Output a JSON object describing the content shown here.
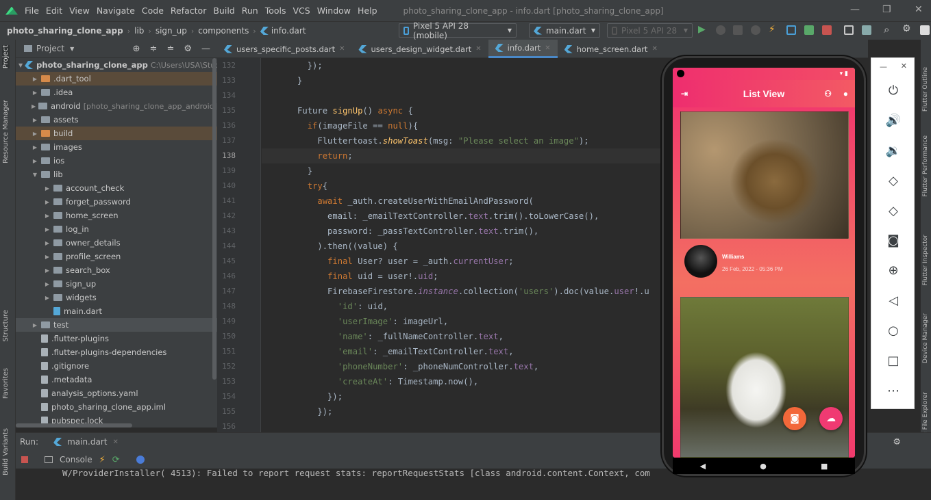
{
  "menubar": {
    "items": [
      "File",
      "Edit",
      "View",
      "Navigate",
      "Code",
      "Refactor",
      "Build",
      "Run",
      "Tools",
      "VCS",
      "Window",
      "Help"
    ],
    "window_title": "photo_sharing_clone_app - info.dart [photo_sharing_clone_app]"
  },
  "breadcrumb": {
    "items": [
      "photo_sharing_clone_app",
      "lib",
      "sign_up",
      "components",
      "info.dart"
    ]
  },
  "toolbar": {
    "device": "Pixel 5 API 28 (mobile)",
    "run_config": "main.dart",
    "device_disabled": "Pixel 5 API 28"
  },
  "project_panel": {
    "title": "Project",
    "root": {
      "name": "photo_sharing_clone_app",
      "path": "C:\\Users\\USA\\Studio"
    },
    "items": [
      {
        "label": ".dart_tool",
        "depth": 1,
        "expandable": true,
        "kind": "folder-orange"
      },
      {
        "label": ".idea",
        "depth": 1,
        "expandable": true,
        "kind": "folder"
      },
      {
        "label": "android",
        "hint": "[photo_sharing_clone_app_android]",
        "depth": 1,
        "expandable": true,
        "kind": "folder"
      },
      {
        "label": "assets",
        "depth": 1,
        "expandable": true,
        "kind": "folder"
      },
      {
        "label": "build",
        "depth": 1,
        "expandable": true,
        "kind": "folder-orange"
      },
      {
        "label": "images",
        "depth": 1,
        "expandable": true,
        "kind": "folder"
      },
      {
        "label": "ios",
        "depth": 1,
        "expandable": true,
        "kind": "folder"
      },
      {
        "label": "lib",
        "depth": 1,
        "expandable": true,
        "expanded": true,
        "kind": "folder"
      },
      {
        "label": "account_check",
        "depth": 2,
        "expandable": true,
        "kind": "folder"
      },
      {
        "label": "forget_password",
        "depth": 2,
        "expandable": true,
        "kind": "folder"
      },
      {
        "label": "home_screen",
        "depth": 2,
        "expandable": true,
        "kind": "folder"
      },
      {
        "label": "log_in",
        "depth": 2,
        "expandable": true,
        "kind": "folder"
      },
      {
        "label": "owner_details",
        "depth": 2,
        "expandable": true,
        "kind": "folder"
      },
      {
        "label": "profile_screen",
        "depth": 2,
        "expandable": true,
        "kind": "folder"
      },
      {
        "label": "search_box",
        "depth": 2,
        "expandable": true,
        "kind": "folder"
      },
      {
        "label": "sign_up",
        "depth": 2,
        "expandable": true,
        "kind": "folder"
      },
      {
        "label": "widgets",
        "depth": 2,
        "expandable": true,
        "kind": "folder"
      },
      {
        "label": "main.dart",
        "depth": 2,
        "expandable": false,
        "kind": "dart"
      },
      {
        "label": "test",
        "depth": 1,
        "expandable": true,
        "kind": "folder",
        "selected": true
      },
      {
        "label": ".flutter-plugins",
        "depth": 1,
        "expandable": false,
        "kind": "file"
      },
      {
        "label": ".flutter-plugins-dependencies",
        "depth": 1,
        "expandable": false,
        "kind": "file"
      },
      {
        "label": ".gitignore",
        "depth": 1,
        "expandable": false,
        "kind": "file"
      },
      {
        "label": ".metadata",
        "depth": 1,
        "expandable": false,
        "kind": "file"
      },
      {
        "label": "analysis_options.yaml",
        "depth": 1,
        "expandable": false,
        "kind": "file"
      },
      {
        "label": "photo_sharing_clone_app.iml",
        "depth": 1,
        "expandable": false,
        "kind": "file"
      },
      {
        "label": "pubspec.lock",
        "depth": 1,
        "expandable": false,
        "kind": "file"
      }
    ]
  },
  "editor": {
    "tabs": [
      {
        "label": "users_specific_posts.dart",
        "active": false
      },
      {
        "label": "users_design_widget.dart",
        "active": false
      },
      {
        "label": "info.dart",
        "active": true
      },
      {
        "label": "home_screen.dart",
        "active": false
      }
    ],
    "line_numbers": [
      "132",
      "133",
      "134",
      "135",
      "136",
      "137",
      "138",
      "139",
      "140",
      "141",
      "142",
      "143",
      "144",
      "145",
      "146",
      "147",
      "148",
      "149",
      "150",
      "151",
      "152",
      "153",
      "154",
      "155",
      "156"
    ],
    "current_line": "138"
  },
  "left_strip": [
    "Project",
    "Resource Manager",
    "Structure",
    "Favorites",
    "Build Variants"
  ],
  "right_strip": [
    "Flutter Outline",
    "Flutter Performance",
    "Flutter Inspector",
    "Device Manager",
    "Device File Explorer"
  ],
  "run_panel": {
    "run_label": "Run:",
    "config_tab": "main.dart",
    "console_tab": "Console",
    "log_line": "W/ProviderInstaller( 4513): Failed to report request stats: reportRequestStats [class android.content.Context, com"
  },
  "phone": {
    "app_title": "List View",
    "post_user_name": "Williams",
    "post_date": "26 Feb, 2022 - 05:36 PM",
    "colors": {
      "primary": "#ee2d6f",
      "secondary": "#f36f62",
      "fab_camera": "#f36f3a",
      "fab_upload": "#f03a72"
    }
  },
  "emulator_controls": [
    "power-icon",
    "volume-up-icon",
    "volume-down-icon",
    "rotate-left-icon",
    "rotate-right-icon",
    "camera-icon",
    "zoom-icon",
    "back-icon",
    "home-icon",
    "overview-icon",
    "more-icon"
  ]
}
